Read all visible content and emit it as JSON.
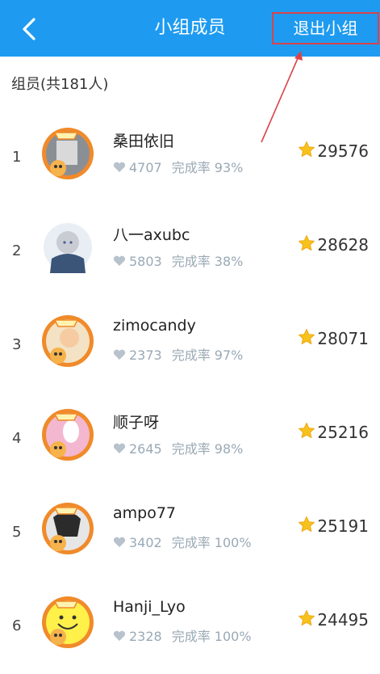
{
  "header": {
    "title": "小组成员",
    "exit_label": "退出小组"
  },
  "member_count": "组员(共181人)",
  "members": [
    {
      "rank": "1",
      "name": "桑田依旧",
      "likes": "4707",
      "completion": "完成率 93%",
      "score": "29576"
    },
    {
      "rank": "2",
      "name": "八一axubc",
      "likes": "5803",
      "completion": "完成率 38%",
      "score": "28628"
    },
    {
      "rank": "3",
      "name": "zimocandy",
      "likes": "2373",
      "completion": "完成率 97%",
      "score": "28071"
    },
    {
      "rank": "4",
      "name": "顺子呀",
      "likes": "2645",
      "completion": "完成率 98%",
      "score": "25216"
    },
    {
      "rank": "5",
      "name": "ampo77",
      "likes": "3402",
      "completion": "完成率 100%",
      "score": "25191"
    },
    {
      "rank": "6",
      "name": "Hanji_Lyo",
      "likes": "2328",
      "completion": "完成率 100%",
      "score": "24495"
    }
  ],
  "colors": {
    "header": "#1e9bf0",
    "annotation": "#d9434a",
    "star": "#f7c21b",
    "meta": "#9aa9b5"
  }
}
